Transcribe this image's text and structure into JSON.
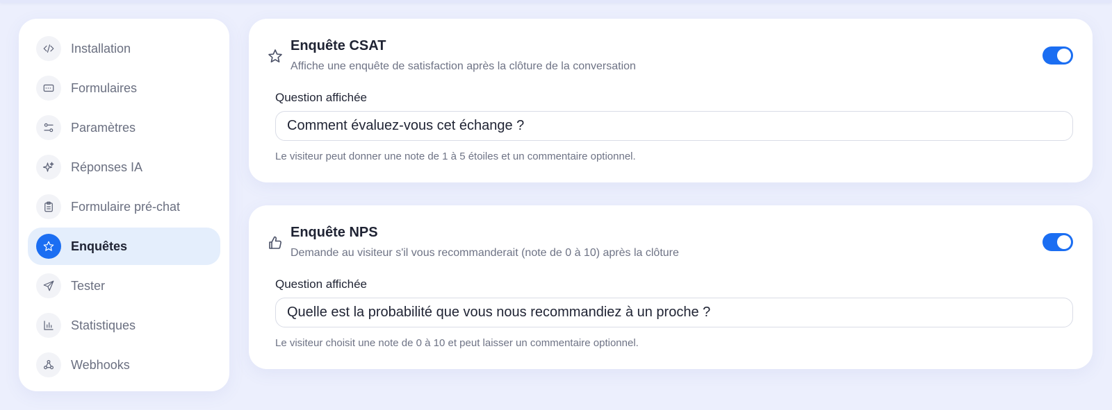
{
  "sidebar": {
    "items": [
      {
        "label": "Installation",
        "icon": "code-icon",
        "active": false
      },
      {
        "label": "Formulaires",
        "icon": "form-icon",
        "active": false
      },
      {
        "label": "Paramètres",
        "icon": "sliders-icon",
        "active": false
      },
      {
        "label": "Réponses IA",
        "icon": "sparkles-icon",
        "active": false
      },
      {
        "label": "Formulaire pré-chat",
        "icon": "clipboard-icon",
        "active": false
      },
      {
        "label": "Enquêtes",
        "icon": "star-icon",
        "active": true
      },
      {
        "label": "Tester",
        "icon": "send-icon",
        "active": false
      },
      {
        "label": "Statistiques",
        "icon": "bar-chart-icon",
        "active": false
      },
      {
        "label": "Webhooks",
        "icon": "webhook-icon",
        "active": false
      }
    ]
  },
  "csat": {
    "icon": "star-icon",
    "title": "Enquête CSAT",
    "subtitle": "Affiche une enquête de satisfaction après la clôture de la conversation",
    "enabled": true,
    "field_label": "Question affichée",
    "field_value": "Comment évaluez-vous cet échange ?",
    "hint": "Le visiteur peut donner une note de 1 à 5 étoiles et un commentaire optionnel."
  },
  "nps": {
    "icon": "thumbs-up-icon",
    "title": "Enquête NPS",
    "subtitle": "Demande au visiteur s'il vous recommanderait (note de 0 à 10) après la clôture",
    "enabled": true,
    "field_label": "Question affichée",
    "field_value": "Quelle est la probabilité que vous nous recommandiez à un proche ?",
    "hint": "Le visiteur choisit une note de 0 à 10 et peut laisser un commentaire optionnel."
  },
  "colors": {
    "accent": "#1b6ef2",
    "background": "#eceffd",
    "active_nav": "#e4eefc"
  }
}
